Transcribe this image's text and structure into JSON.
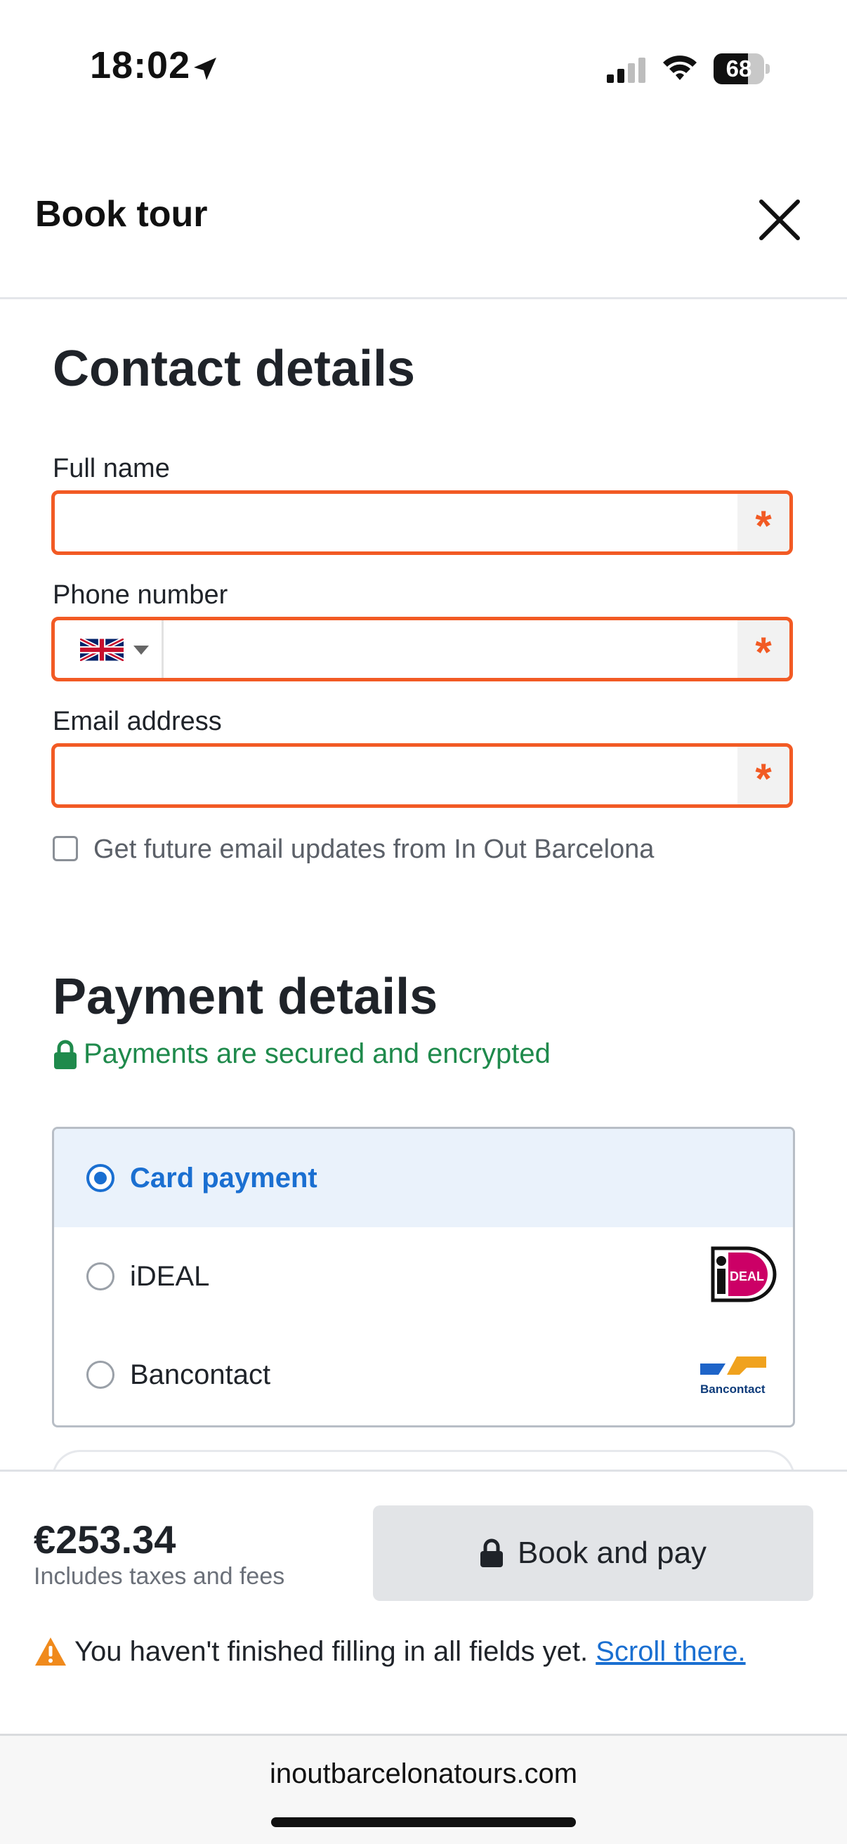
{
  "status_bar": {
    "time": "18:02",
    "battery": "68",
    "battery_level": 0.68
  },
  "header": {
    "title": "Book tour"
  },
  "contact": {
    "title": "Contact details",
    "full_name_label": "Full name",
    "full_name_value": "",
    "phone_label": "Phone number",
    "phone_value": "",
    "email_label": "Email address",
    "email_value": "",
    "required_mark": "*",
    "newsletter_label": "Get future email updates from In Out Barcelona",
    "newsletter_checked": false
  },
  "payment": {
    "title": "Payment details",
    "secure_text": "Payments are secured and encrypted",
    "options": [
      {
        "label": "Card payment",
        "selected": true
      },
      {
        "label": "iDEAL",
        "selected": false,
        "logo_icon": "ideal-logo-icon"
      },
      {
        "label": "Bancontact",
        "selected": false,
        "logo_icon": "bancontact-logo-icon"
      }
    ],
    "ideal_logo_text": "DEAL",
    "bancontact_logo_text": "Bancontact"
  },
  "footer_bar": {
    "price": "€253.34",
    "price_note": "Includes taxes and fees",
    "book_button": "Book and pay",
    "warning_text": "You haven't finished filling in all fields yet.",
    "warning_link": "Scroll there."
  },
  "browser": {
    "url": "inoutbarcelonatours.com"
  },
  "colors": {
    "error_border": "#f25a24",
    "accent_blue": "#1a6fd1",
    "secure_green": "#1f8a4c",
    "selected_bg": "#eaf2fb",
    "warning_orange": "#f08a1c"
  }
}
